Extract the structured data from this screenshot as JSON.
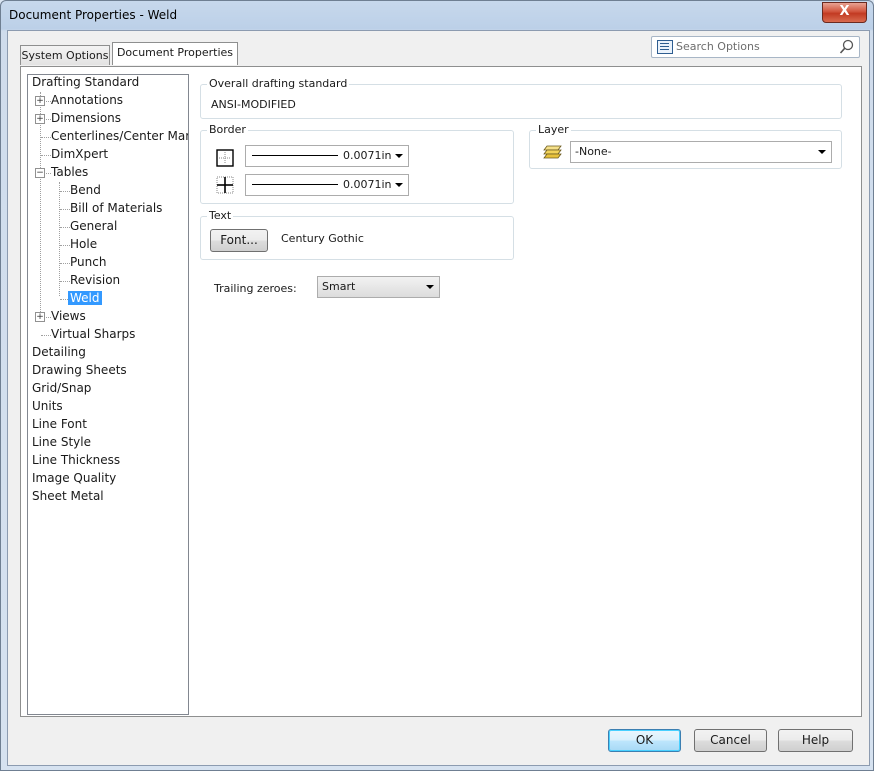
{
  "window": {
    "title": "Document Properties - Weld",
    "close_label": "X"
  },
  "tabs": [
    {
      "label": "System Options"
    },
    {
      "label": "Document Properties"
    }
  ],
  "search": {
    "placeholder": "Search Options"
  },
  "tree": {
    "items": [
      {
        "label": "Drafting Standard"
      },
      {
        "label": "Annotations"
      },
      {
        "label": "Dimensions"
      },
      {
        "label": "Centerlines/Center Marks"
      },
      {
        "label": "DimXpert"
      },
      {
        "label": "Tables"
      },
      {
        "label": "Bend"
      },
      {
        "label": "Bill of Materials"
      },
      {
        "label": "General"
      },
      {
        "label": "Hole"
      },
      {
        "label": "Punch"
      },
      {
        "label": "Revision"
      },
      {
        "label": "Weld"
      },
      {
        "label": "Views"
      },
      {
        "label": "Virtual Sharps"
      },
      {
        "label": "Detailing"
      },
      {
        "label": "Drawing Sheets"
      },
      {
        "label": "Grid/Snap"
      },
      {
        "label": "Units"
      },
      {
        "label": "Line Font"
      },
      {
        "label": "Line Style"
      },
      {
        "label": "Line Thickness"
      },
      {
        "label": "Image Quality"
      },
      {
        "label": "Sheet Metal"
      }
    ],
    "selected": "Weld"
  },
  "overall": {
    "label": "Overall drafting standard",
    "value": "ANSI-MODIFIED"
  },
  "border": {
    "label": "Border",
    "rows": [
      {
        "icon": "border-outer-icon",
        "value": "0.0071in"
      },
      {
        "icon": "border-inner-icon",
        "value": "0.0071in"
      }
    ]
  },
  "layer": {
    "label": "Layer",
    "icon": "layer-stack-icon",
    "value": "-None-"
  },
  "text": {
    "label": "Text",
    "font_button": "Font...",
    "font_name": "Century Gothic"
  },
  "trailing": {
    "label": "Trailing zeroes:",
    "value": "Smart"
  },
  "footer": {
    "ok": "OK",
    "cancel": "Cancel",
    "help": "Help"
  },
  "colors": {
    "selection": "#3399ff",
    "title_gradient": "#c7d8ec",
    "close": "#c23a22"
  }
}
